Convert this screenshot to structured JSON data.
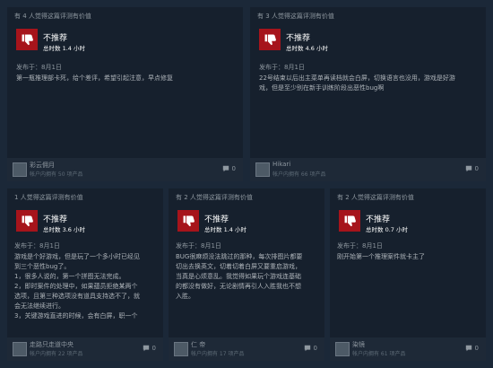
{
  "reviews": [
    {
      "helpful": "有 4 人觉得这篇评测有价值",
      "verdict": "不推荐",
      "hours": "总时数 1.4 小时",
      "posted": "发布于：8月1日",
      "body": [
        "第一瓶推理部卡死，给个差评，希望引起注意，早点修复"
      ],
      "username": "彩云佣月",
      "userinfo": "帐户内拥有 50 项产品",
      "comments": "0"
    },
    {
      "helpful": "有 3 人觉得这篇评测有价值",
      "verdict": "不推荐",
      "hours": "总时数 4.6 小时",
      "posted": "发布于：8月1日",
      "body": [
        "22号结束以后出主菜单再读档就会白屏，切换语言也没用，游戏是好游",
        "戏，但是至少别在新手训练阶段出恶性bug啊"
      ],
      "username": "Hikari",
      "userinfo": "帐户内拥有 66 项产品",
      "comments": "0"
    },
    {
      "helpful": "1 人觉得这篇评测有价值",
      "verdict": "不推荐",
      "hours": "总时数 3.6 小时",
      "posted": "发布于：8月1日",
      "body": [
        "游戏是个好游戏，但是玩了一个多小时已经见",
        "到三个恶性bug了。",
        "1，很多人说的，第一个拼图无法完成。",
        "2，即时案件的处理中，如果蕴员拒绝某两个",
        "选项，且第三种选项没有道具支持选不了，就",
        "会无法继续进行。",
        "3，关键游戏直进的时候，会有白屏，职一个"
      ],
      "username": "走路只走道中央",
      "userinfo": "帐户内拥有 22 项产品",
      "comments": "0"
    },
    {
      "helpful": "有 2 人觉得这篇评测有价值",
      "verdict": "不推荐",
      "hours": "总时数 1.4 小时",
      "posted": "发布于：8月1日",
      "body": [
        "BUG很麻烦没法跳过的那种，每次排图片都要",
        "切出去换英文，切着切着白屏又要重启游戏，",
        "当真是心烦意乱。我觉得如果玩个游戏连基础",
        "的都没有做好，无论剧情再引人入胜我也不想",
        "入胜。"
      ],
      "username": "仁 帝",
      "userinfo": "帐户内拥有 17 项产品",
      "comments": "0"
    },
    {
      "helpful": "有 2 人觉得这篇评测有价值",
      "verdict": "不推荐",
      "hours": "总时数 0.7 小时",
      "posted": "发布于：8月1日",
      "body": [
        "刚开始第一个推理案件就卡主了"
      ],
      "username": "染镜",
      "userinfo": "帐户内拥有 61 项产品",
      "comments": "0"
    }
  ]
}
